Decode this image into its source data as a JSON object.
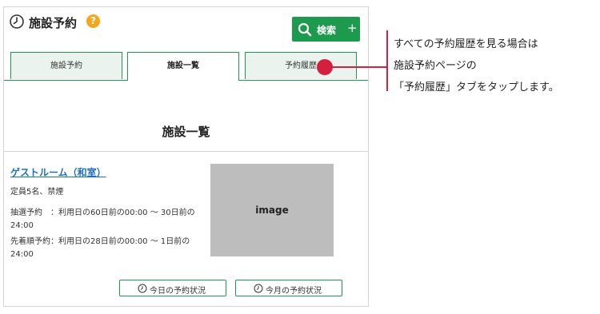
{
  "header": {
    "title": "施設予約",
    "help_label": "?",
    "search_label": "検索",
    "search_plus": "+"
  },
  "tabs": [
    {
      "label": "施設予約",
      "active": false
    },
    {
      "label": "施設一覧",
      "active": true
    },
    {
      "label": "予約履歴",
      "active": false
    }
  ],
  "section_title": "施設一覧",
  "facility": {
    "name": "ゲストルーム（和室）",
    "capacity": "定員5名、禁煙",
    "lottery_line1": "抽選予約　：利用日の60日前の00:00 ～ 30日前の",
    "lottery_line2": "24:00",
    "firstcome_line1": "先着順予約：利用日の28日前の00:00 ～ 1日前の",
    "firstcome_line2": "24:00",
    "image_label": "image"
  },
  "buttons": {
    "today": "今日の予約状況",
    "month": "今月の予約状況"
  },
  "annotation": {
    "line1": "すべての予約履歴を見る場合は",
    "line2": "施設予約ページの",
    "line3": "「予約履歴」タブをタップします。"
  },
  "colors": {
    "accent_green": "#1d9a4d",
    "link_blue": "#1f6fc0",
    "callout_red": "#d4203c",
    "help_orange": "#f2a81d"
  },
  "icons": {
    "header": "clock-icon",
    "search": "magnifier-icon",
    "help": "question-icon",
    "buttons": "clock-icon"
  }
}
